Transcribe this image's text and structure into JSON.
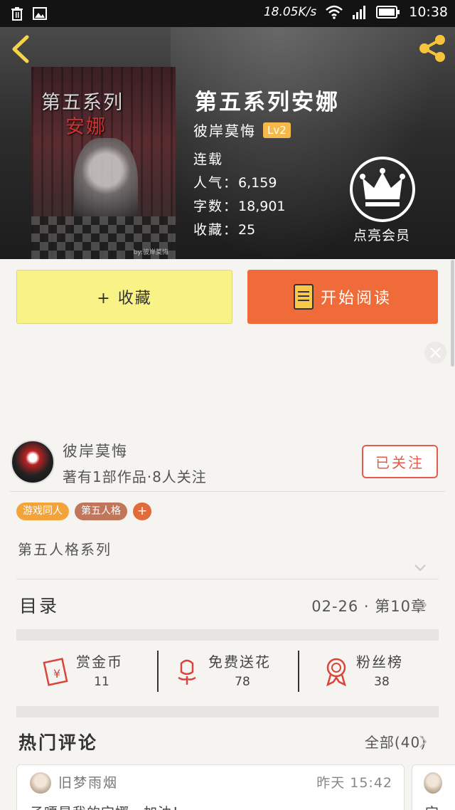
{
  "status_bar": {
    "network_speed": "18.05K/s",
    "time": "10:38",
    "icons": [
      "trash-icon",
      "image-icon",
      "wifi-icon",
      "signal-icon",
      "battery-icon"
    ]
  },
  "header": {
    "back_icon": "chevron-left-icon",
    "share_icon": "share-icon",
    "cover_title_line1": "第五系列",
    "cover_title_line2": "安娜",
    "cover_credit": "by:彼岸莫悔",
    "book_title": "第五系列安娜",
    "author": "彼岸莫悔",
    "level": "Lv2",
    "status": "连载",
    "popularity_label": "人气：",
    "popularity_value": "6,159",
    "words_label": "字数：",
    "words_value": "18,901",
    "favorites_label": "收藏：",
    "favorites_value": "25",
    "vip_label": "点亮会员"
  },
  "actions": {
    "favorite_label": "+ 收藏",
    "read_label": "开始阅读"
  },
  "author_card": {
    "name": "彼岸莫悔",
    "summary": "著有1部作品·8人关注",
    "follow_label": "已关注"
  },
  "tags": [
    "游戏同人",
    "第五人格",
    "+"
  ],
  "intro": "第五人格系列",
  "catalog": {
    "title": "目录",
    "latest": "02-26 · 第10章"
  },
  "stats": [
    {
      "label": "赏金币",
      "value": "11",
      "icon": "red-envelope-icon"
    },
    {
      "label": "免费送花",
      "value": "78",
      "icon": "flower-icon"
    },
    {
      "label": "粉丝榜",
      "value": "38",
      "icon": "award-ribbon-icon"
    }
  ],
  "comments": {
    "title": "热门评论",
    "all_label": "全部(40)",
    "items": [
      {
        "user": "旧梦雨烟",
        "time": "昨天 15:42",
        "text": "子嘎是我的宝娜～加油！"
      },
      {
        "user": "",
        "time": "",
        "text": "宝"
      }
    ]
  },
  "colors": {
    "accent_orange": "#ef6c3a",
    "favorite_yellow": "#f9f286",
    "level_badge": "#f5b94b",
    "follow_red": "#e55a4a"
  }
}
